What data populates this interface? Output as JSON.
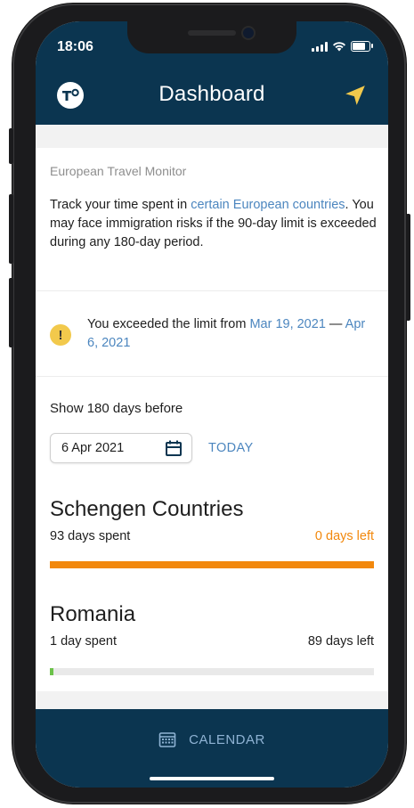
{
  "status_bar": {
    "time": "18:06"
  },
  "header": {
    "title": "Dashboard",
    "logo_icon": "app-logo-icon",
    "action_icon": "location-arrow-icon"
  },
  "intro": {
    "subtitle": "European Travel Monitor",
    "text_before": "Track your time spent in ",
    "link": "certain European countries",
    "text_after": ". You may face immigration risks if the 90-day limit is exceeded during any 180-day period."
  },
  "warning": {
    "icon": "warning-icon",
    "glyph": "!",
    "text": "You exceeded the limit from ",
    "start": "Mar 19, 2021",
    "separator": " — ",
    "end": "Apr 6, 2021"
  },
  "date_picker": {
    "label": "Show 180 days before",
    "value": "6 Apr 2021",
    "icon": "calendar-icon",
    "today_label": "TODAY"
  },
  "regions": [
    {
      "name": "Schengen Countries",
      "spent": "93 days spent",
      "left": "0 days left",
      "progress": 1.0,
      "left_color": "#f2880c",
      "bar_color": "#f2880c"
    },
    {
      "name": "Romania",
      "spent": "1 day spent",
      "left": "89 days left",
      "progress": 0.011,
      "left_color": "#1e1e1e",
      "bar_color": "#6cc24a"
    }
  ],
  "tabbar": {
    "calendar_label": "CALENDAR",
    "calendar_icon": "calendar-grid-icon"
  },
  "colors": {
    "header_bg": "#0b3550",
    "link": "#4c86bf",
    "warning": "#f2c94c"
  }
}
